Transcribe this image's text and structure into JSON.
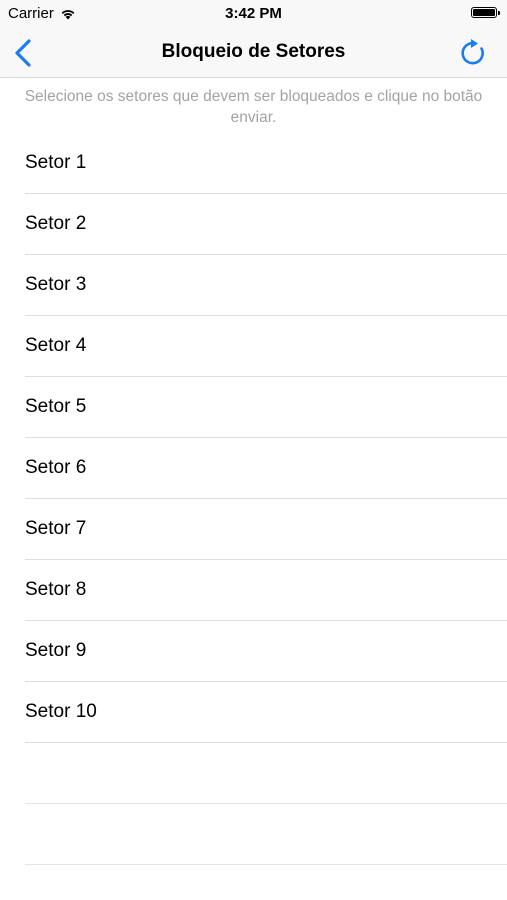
{
  "status_bar": {
    "carrier": "Carrier",
    "time": "3:42 PM"
  },
  "nav": {
    "title": "Bloqueio de Setores",
    "back_icon": "chevron-left-icon",
    "refresh_icon": "refresh-icon",
    "accent_color": "#1a7cf5"
  },
  "instruction": "Selecione os setores que devem ser bloqueados e clique no botão enviar.",
  "sectors": [
    {
      "label": "Setor 1"
    },
    {
      "label": "Setor 2"
    },
    {
      "label": "Setor 3"
    },
    {
      "label": "Setor 4"
    },
    {
      "label": "Setor 5"
    },
    {
      "label": "Setor 6"
    },
    {
      "label": "Setor 7"
    },
    {
      "label": "Setor 8"
    },
    {
      "label": "Setor 9"
    },
    {
      "label": "Setor 10"
    }
  ]
}
